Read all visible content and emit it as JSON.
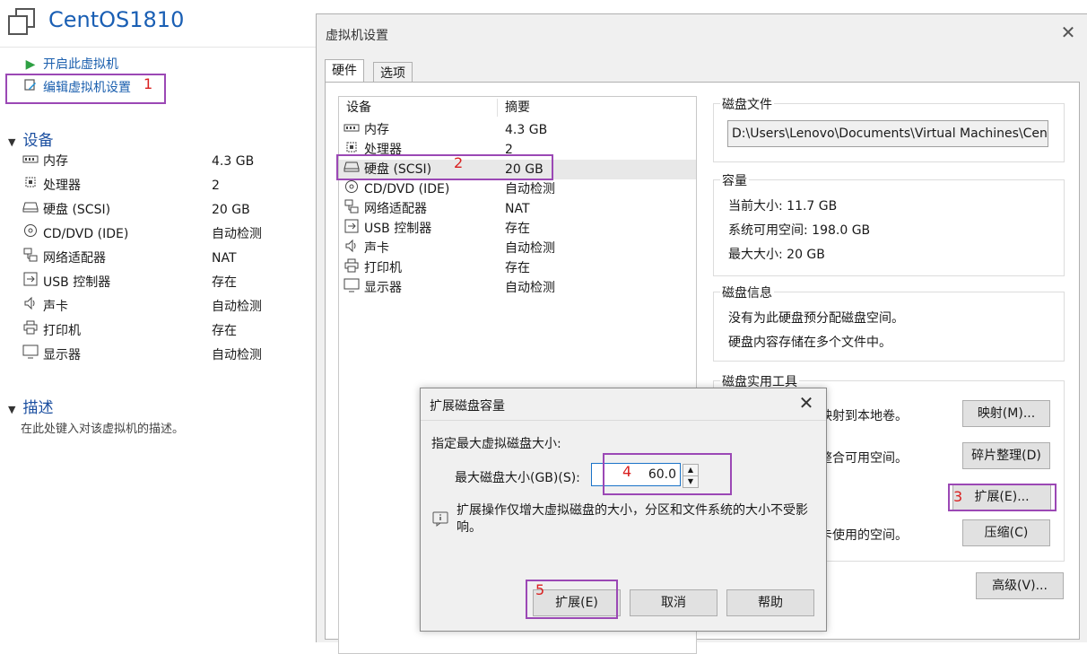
{
  "vm": {
    "title": "CentOS1810",
    "actions": [
      {
        "label": "开启此虚拟机",
        "icon": "play-icon"
      },
      {
        "label": "编辑虚拟机设置",
        "icon": "edit-settings-icon"
      }
    ],
    "devices_header": "设备",
    "devices": [
      {
        "name": "内存",
        "value": "4.3 GB",
        "icon": "memory-icon"
      },
      {
        "name": "处理器",
        "value": "2",
        "icon": "cpu-icon"
      },
      {
        "name": "硬盘 (SCSI)",
        "value": "20 GB",
        "icon": "hard-disk-icon"
      },
      {
        "name": "CD/DVD (IDE)",
        "value": "自动检测",
        "icon": "cd-dvd-icon"
      },
      {
        "name": "网络适配器",
        "value": "NAT",
        "icon": "network-icon"
      },
      {
        "name": "USB 控制器",
        "value": "存在",
        "icon": "usb-icon"
      },
      {
        "name": "声卡",
        "value": "自动检测",
        "icon": "speaker-icon"
      },
      {
        "name": "打印机",
        "value": "存在",
        "icon": "printer-icon"
      },
      {
        "name": "显示器",
        "value": "自动检测",
        "icon": "monitor-icon"
      }
    ],
    "description_header": "描述",
    "description_placeholder": "在此处键入对该虚拟机的描述。"
  },
  "settings": {
    "title": "虚拟机设置",
    "tabs": [
      "硬件",
      "选项"
    ],
    "list_headers": {
      "device": "设备",
      "summary": "摘要"
    },
    "devices": [
      {
        "name": "内存",
        "value": "4.3 GB"
      },
      {
        "name": "处理器",
        "value": "2"
      },
      {
        "name": "硬盘 (SCSI)",
        "value": "20 GB"
      },
      {
        "name": "CD/DVD (IDE)",
        "value": "自动检测"
      },
      {
        "name": "网络适配器",
        "value": "NAT"
      },
      {
        "name": "USB 控制器",
        "value": "存在"
      },
      {
        "name": "声卡",
        "value": "自动检测"
      },
      {
        "name": "打印机",
        "value": "存在"
      },
      {
        "name": "显示器",
        "value": "自动检测"
      }
    ],
    "disk_file": {
      "title": "磁盘文件",
      "path": "D:\\Users\\Lenovo\\Documents\\Virtual Machines\\CentOS"
    },
    "capacity": {
      "title": "容量",
      "current": "当前大小: 11.7 GB",
      "available": "系统可用空间: 198.0 GB",
      "max": "最大大小: 20 GB"
    },
    "disk_info": {
      "title": "磁盘信息",
      "line1": "没有为此硬盘预分配磁盘空间。",
      "line2": "硬盘内容存储在多个文件中。"
    },
    "utilities": {
      "title": "磁盘实用工具",
      "map_text": "映射到本地卷。",
      "map_button": "映射(M)...",
      "defrag_text": "整合可用空间。",
      "defrag_button": "碎片整理(D)",
      "expand_button": "扩展(E)...",
      "compact_text": "卡使用的空间。",
      "compact_button": "压缩(C)"
    },
    "advanced_button": "高级(V)..."
  },
  "expand_dialog": {
    "title": "扩展磁盘容量",
    "prompt": "指定最大虚拟磁盘大小:",
    "size_label": "最大磁盘大小(GB)(S):",
    "size_value": "60.0",
    "info": "扩展操作仅增大虚拟磁盘的大小，分区和文件系统的大小不受影响。",
    "buttons": {
      "expand": "扩展(E)",
      "cancel": "取消",
      "help": "帮助"
    }
  },
  "annotations": [
    "1",
    "2",
    "3",
    "4",
    "5"
  ],
  "colors": {
    "annotation_box": "#9b48b5",
    "annotation_number": "#d92020",
    "link_blue": "#1b5fae"
  }
}
